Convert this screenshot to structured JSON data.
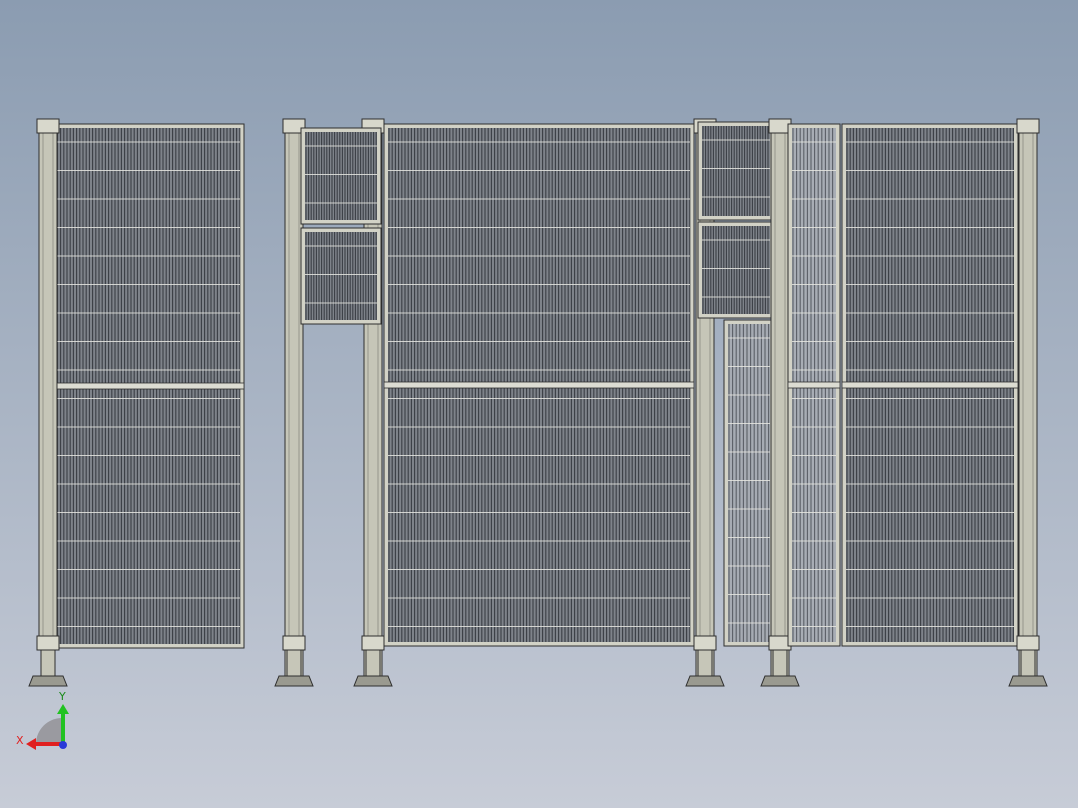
{
  "view": {
    "background_top": "#8b9cb1",
    "background_bottom": "#c7ccd7"
  },
  "colors": {
    "post": "#c6c6b8",
    "post_edge": "#2e2e2e",
    "panel_frame": "#d2d2c6",
    "mesh_bg": "#7e838a",
    "mesh_bar": "#3a3e44",
    "mesh_rail": "#dcdcd2",
    "foot": "#9a9a90"
  },
  "triad": {
    "x_label": "X",
    "y_label": "Y",
    "x_color": "#e02020",
    "y_color": "#22c222",
    "z_color": "#2a3ad8"
  }
}
